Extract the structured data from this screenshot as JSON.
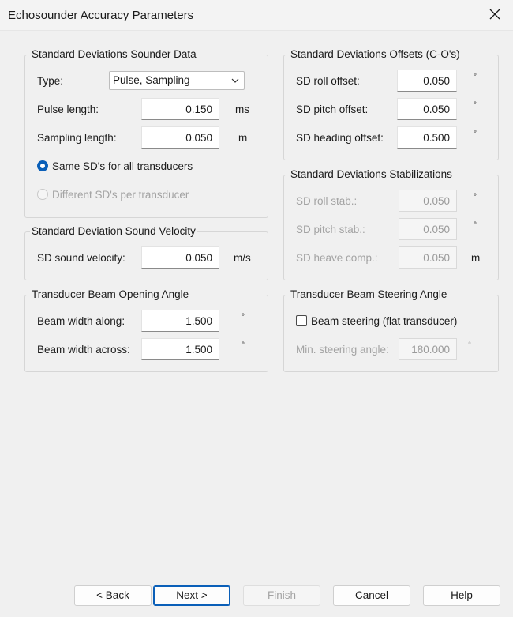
{
  "window": {
    "title": "Echosounder Accuracy Parameters",
    "close_icon": "close-icon"
  },
  "sounder": {
    "title": "Standard Deviations Sounder Data",
    "type_label": "Type:",
    "type_value": "Pulse, Sampling",
    "pulse_label": "Pulse length:",
    "pulse_value": "0.150",
    "pulse_unit": "ms",
    "sampling_label": "Sampling length:",
    "sampling_value": "0.050",
    "sampling_unit": "m",
    "radio_same": "Same SD's for all transducers",
    "radio_diff": "Different SD's per transducer"
  },
  "velocity": {
    "title": "Standard Deviation Sound Velocity",
    "label": "SD sound velocity:",
    "value": "0.050",
    "unit": "m/s"
  },
  "opening": {
    "title": "Transducer Beam Opening Angle",
    "along_label": "Beam width along:",
    "along_value": "1.500",
    "across_label": "Beam width across:",
    "across_value": "1.500",
    "deg": "°"
  },
  "offsets": {
    "title": "Standard Deviations Offsets (C-O's)",
    "roll_label": "SD roll offset:",
    "roll_value": "0.050",
    "pitch_label": "SD pitch offset:",
    "pitch_value": "0.050",
    "heading_label": "SD heading offset:",
    "heading_value": "0.500",
    "deg": "°"
  },
  "stab": {
    "title": "Standard Deviations Stabilizations",
    "roll_label": "SD roll stab.:",
    "roll_value": "0.050",
    "pitch_label": "SD pitch stab.:",
    "pitch_value": "0.050",
    "heave_label": "SD heave comp.:",
    "heave_value": "0.050",
    "heave_unit": "m",
    "deg": "°"
  },
  "steering": {
    "title": "Transducer Beam Steering Angle",
    "checkbox_label": "Beam steering (flat transducer)",
    "min_label": "Min. steering angle:",
    "min_value": "180.000",
    "deg": "°"
  },
  "buttons": {
    "back": "< Back",
    "next": "Next >",
    "finish": "Finish",
    "cancel": "Cancel",
    "help": "Help"
  }
}
